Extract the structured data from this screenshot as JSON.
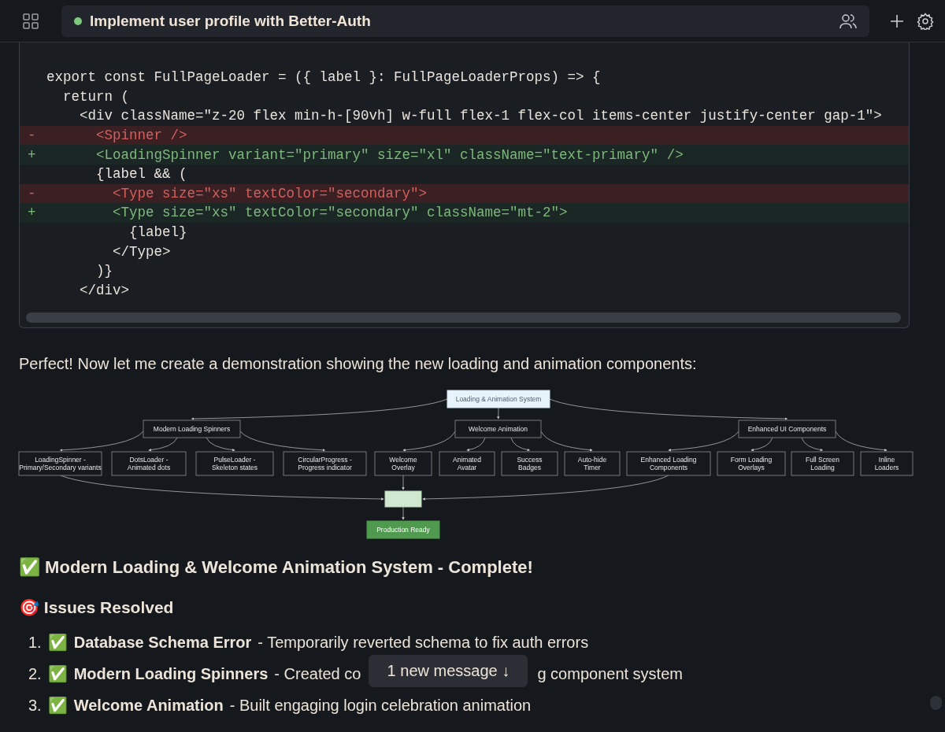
{
  "header": {
    "title": "Implement user profile with Better-Auth"
  },
  "code": {
    "lines": [
      {
        "kind": "context",
        "text": "export const FullPageLoader = ({ label }: FullPageLoaderProps) => {"
      },
      {
        "kind": "context",
        "text": "  return ("
      },
      {
        "kind": "context",
        "text": "    <div className=\"z-20 flex min-h-[90vh] w-full flex-1 flex-col items-center justify-center gap-1\">"
      },
      {
        "kind": "removed",
        "marker": "-",
        "text": "      <Spinner />"
      },
      {
        "kind": "added",
        "marker": "+",
        "text": "      <LoadingSpinner variant=\"primary\" size=\"xl\" className=\"text-primary\" />"
      },
      {
        "kind": "context",
        "text": "      {label && ("
      },
      {
        "kind": "removed",
        "marker": "-",
        "text": "        <Type size=\"xs\" textColor=\"secondary\">"
      },
      {
        "kind": "added",
        "marker": "+",
        "text": "        <Type size=\"xs\" textColor=\"secondary\" className=\"mt-2\">"
      },
      {
        "kind": "context",
        "text": "          {label}"
      },
      {
        "kind": "context",
        "text": "        </Type>"
      },
      {
        "kind": "context",
        "text": "      )}"
      },
      {
        "kind": "context",
        "text": "    </div>"
      }
    ]
  },
  "intro": "Perfect! Now let me create a demonstration showing the new loading and animation components:",
  "diagram": {
    "root": {
      "label": "Loading & Animation System",
      "children": [
        {
          "label": "Modern Loading Spinners",
          "children": [
            {
              "label": "LoadingSpinner - Primary/Secondary variants",
              "merges": true
            },
            {
              "label": "DotsLoader - Animated dots",
              "merges": false
            },
            {
              "label": "PulseLoader - Skeleton states",
              "merges": false
            },
            {
              "label": "CircularProgress - Progress indicator",
              "merges": false
            }
          ]
        },
        {
          "label": "Welcome Animation",
          "children": [
            {
              "label": "Welcome Overlay",
              "merges": true
            },
            {
              "label": "Animated Avatar",
              "merges": false
            },
            {
              "label": "Success Badges",
              "merges": false
            },
            {
              "label": "Auto-hide Timer",
              "merges": false
            }
          ]
        },
        {
          "label": "Enhanced UI Components",
          "children": [
            {
              "label": "Enhanced Loading Components",
              "merges": true
            },
            {
              "label": "Form Loading Overlays",
              "merges": false
            },
            {
              "label": "Full Screen Loading",
              "merges": false
            },
            {
              "label": "Inline Loaders",
              "merges": false
            }
          ]
        }
      ]
    },
    "result": {
      "label": "Production Ready"
    }
  },
  "heading": "✅ Modern Loading & Welcome Animation System - Complete!",
  "subheading": "🎯 Issues Resolved",
  "items": [
    {
      "number": "1.",
      "check": "✅",
      "title": "Database Schema Error",
      "parts": [
        "- Temporarily reverted schema to fix auth errors"
      ]
    },
    {
      "number": "2.",
      "check": "✅",
      "title": "Modern Loading Spinners",
      "parts": [
        "- Created co",
        "g component system"
      ]
    },
    {
      "number": "3.",
      "check": "✅",
      "title": "Welcome Animation",
      "parts": [
        "- Built engaging login celebration animation"
      ]
    }
  ],
  "toast": {
    "label": "1 new message ↓"
  }
}
